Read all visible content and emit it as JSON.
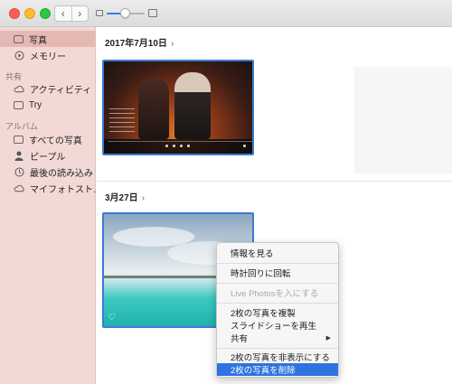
{
  "toolbar": {
    "back_icon": "chevron-left-icon",
    "forward_icon": "chevron-right-icon",
    "back_glyph": "‹",
    "forward_glyph": "›",
    "zoom": 0.4
  },
  "sidebar": {
    "items_top": [
      {
        "label": "写真",
        "icon": "photo-library-icon",
        "selected": true
      },
      {
        "label": "メモリー",
        "icon": "memories-icon",
        "selected": false
      }
    ],
    "shared_header": "共有",
    "shared_items": [
      {
        "label": "アクティビティ",
        "icon": "cloud-icon"
      },
      {
        "label": "Try",
        "icon": "folder-icon"
      }
    ],
    "albums_header": "アルバム",
    "album_items": [
      {
        "label": "すべての写真",
        "icon": "photo-library-icon"
      },
      {
        "label": "ピープル",
        "icon": "person-icon"
      },
      {
        "label": "最後の読み込み",
        "icon": "clock-icon"
      },
      {
        "label": "マイフォトスト…",
        "icon": "cloud-icon"
      }
    ]
  },
  "main": {
    "sections": [
      {
        "date": "2017年7月10日"
      },
      {
        "date": "3月27日"
      }
    ],
    "chevron": "›",
    "favorite_glyph": "♡"
  },
  "context_menu": {
    "items": [
      {
        "label": "情報を見る",
        "enabled": true
      },
      {
        "label": "時計回りに回転",
        "enabled": true
      },
      {
        "label": "Live Photosを入にする",
        "enabled": false
      },
      {
        "label": "2枚の写真を複製",
        "enabled": true
      },
      {
        "label": "スライドショーを再生",
        "enabled": true
      },
      {
        "label": "共有",
        "enabled": true,
        "submenu": true
      },
      {
        "label": "2枚の写真を非表示にする",
        "enabled": true
      },
      {
        "label": "2枚の写真を削除",
        "enabled": true,
        "highlighted": true
      }
    ],
    "submenu_arrow": "▶"
  },
  "colors": {
    "sidebar_bg": "#f3d9d6",
    "sidebar_selected": "#e6b8b3",
    "selection_border": "#3a7bd5",
    "menu_highlight": "#2e73e0"
  }
}
